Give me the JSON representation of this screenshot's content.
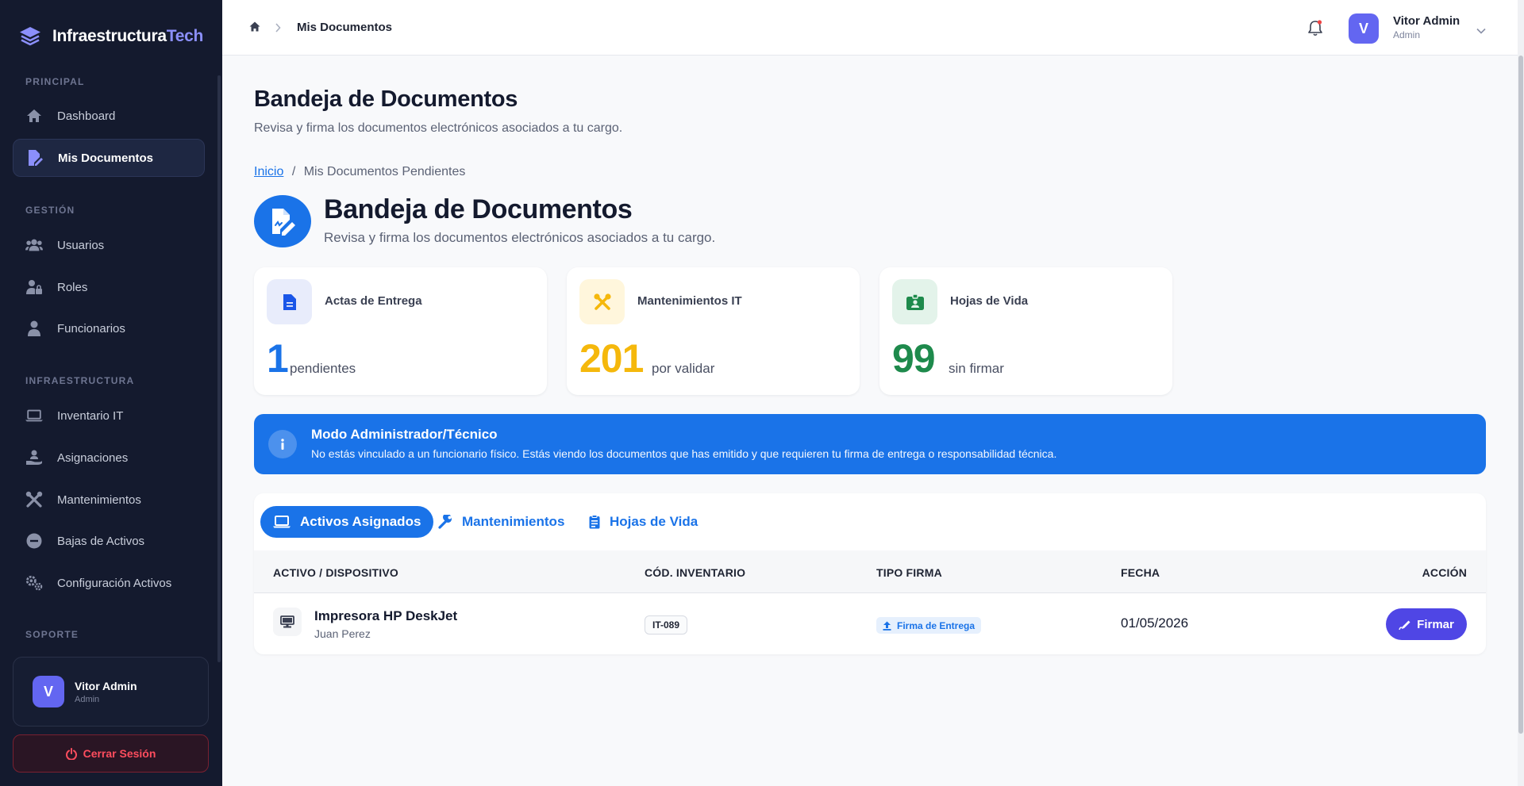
{
  "brand": {
    "name_part1": "Infraestructura",
    "name_part2": "Tech"
  },
  "sidebar": {
    "sections": {
      "principal": "PRINCIPAL",
      "gestion": "GESTIÓN",
      "infraestructura": "INFRAESTRUCTURA",
      "soporte": "SOPORTE"
    },
    "items": [
      {
        "label": "Dashboard",
        "icon": "home-icon"
      },
      {
        "label": "Mis Documentos",
        "icon": "document-sign-icon",
        "active": true
      },
      {
        "label": "Usuarios",
        "icon": "users-icon"
      },
      {
        "label": "Roles",
        "icon": "user-lock-icon"
      },
      {
        "label": "Funcionarios",
        "icon": "user-icon"
      },
      {
        "label": "Inventario IT",
        "icon": "laptop-icon"
      },
      {
        "label": "Asignaciones",
        "icon": "hand-user-icon"
      },
      {
        "label": "Mantenimientos",
        "icon": "tools-icon"
      },
      {
        "label": "Bajas de Activos",
        "icon": "minus-circle-icon"
      },
      {
        "label": "Configuración Activos",
        "icon": "gears-icon"
      }
    ],
    "user": {
      "initial": "V",
      "name": "Vitor Admin",
      "role": "Admin"
    },
    "logout_label": "Cerrar Sesión"
  },
  "topbar": {
    "breadcrumb": "Mis Documentos",
    "user": {
      "initial": "V",
      "name": "Vitor Admin",
      "role": "Admin"
    }
  },
  "page": {
    "title": "Bandeja de Documentos",
    "subtitle": "Revisa y firma los documentos electrónicos asociados a tu cargo.",
    "crumb_home": "Inicio",
    "crumb_sep": "/",
    "crumb_current": "Mis Documentos Pendientes",
    "hero_title": "Bandeja de Documentos",
    "hero_subtitle": "Revisa y firma los documentos electrónicos asociados a tu cargo."
  },
  "stats": [
    {
      "label": "Actas de Entrega",
      "value": "1",
      "unit": "pendientes",
      "color": "#1a73e8"
    },
    {
      "label": "Mantenimientos IT",
      "value": "201",
      "unit": "por validar",
      "color": "#f5b80c"
    },
    {
      "label": "Hojas de Vida",
      "value": "99",
      "unit": "sin firmar",
      "color": "#1e8a4c"
    }
  ],
  "alert": {
    "title": "Modo Administrador/Técnico",
    "text": "No estás vinculado a un funcionario físico. Estás viendo los documentos que has emitido y que requieren tu firma de entrega o responsabilidad técnica."
  },
  "tabs": [
    {
      "label": "Activos Asignados",
      "active": true
    },
    {
      "label": "Mantenimientos"
    },
    {
      "label": "Hojas de Vida"
    }
  ],
  "table": {
    "columns": [
      "ACTIVO / DISPOSITIVO",
      "CÓD. INVENTARIO",
      "TIPO FIRMA",
      "FECHA",
      "ACCIÓN"
    ],
    "rows": [
      {
        "device": "Impresora HP DeskJet",
        "owner": "Juan Perez",
        "code": "IT-089",
        "sign_type": "Firma de Entrega",
        "date": "01/05/2026",
        "action": "Firmar"
      }
    ]
  },
  "colors": {
    "primary": "#1a73e8",
    "accent": "#6366f1",
    "sidebar_bg": "#141a2e",
    "danger": "#ff4d5e"
  }
}
